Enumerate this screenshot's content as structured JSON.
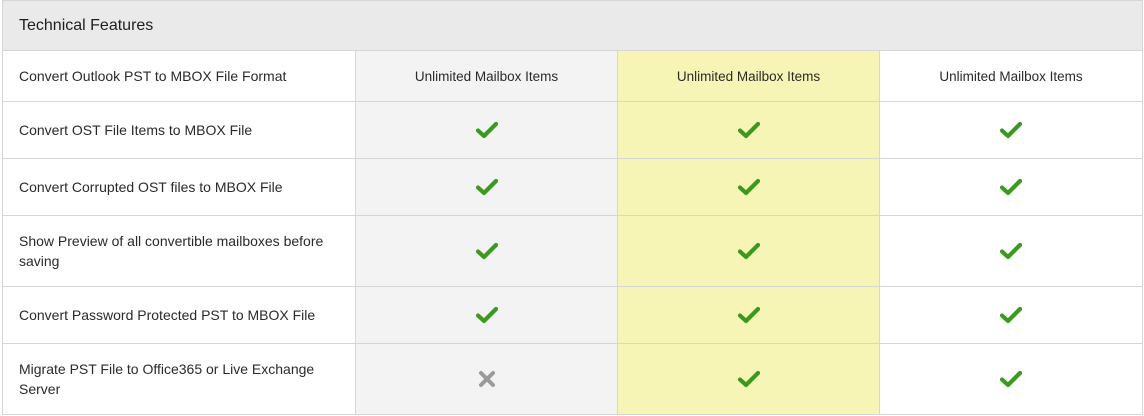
{
  "header": {
    "title": "Technical Features"
  },
  "rows": [
    {
      "feature": "Convert Outlook PST to MBOX File Format",
      "values": [
        {
          "type": "text",
          "text": "Unlimited Mailbox Items"
        },
        {
          "type": "text",
          "text": "Unlimited Mailbox Items"
        },
        {
          "type": "text",
          "text": "Unlimited Mailbox Items"
        }
      ]
    },
    {
      "feature": "Convert OST File Items to MBOX File",
      "values": [
        {
          "type": "check-icon"
        },
        {
          "type": "check-icon"
        },
        {
          "type": "check-icon"
        }
      ]
    },
    {
      "feature": "Convert Corrupted OST files to MBOX File",
      "values": [
        {
          "type": "check-icon"
        },
        {
          "type": "check-icon"
        },
        {
          "type": "check-icon"
        }
      ]
    },
    {
      "feature": "Show Preview of all convertible mailboxes before saving",
      "values": [
        {
          "type": "check-icon"
        },
        {
          "type": "check-icon"
        },
        {
          "type": "check-icon"
        }
      ]
    },
    {
      "feature": "Convert Password Protected PST to MBOX File",
      "values": [
        {
          "type": "check-icon"
        },
        {
          "type": "check-icon"
        },
        {
          "type": "check-icon"
        }
      ]
    },
    {
      "feature": "Migrate PST File to Office365 or Live Exchange Server",
      "values": [
        {
          "type": "cross-icon"
        },
        {
          "type": "check-icon"
        },
        {
          "type": "check-icon"
        }
      ]
    }
  ],
  "colors": {
    "check": "#3a9a1f",
    "cross": "#9a9a9a",
    "highlight_column": "#f7f5b5",
    "muted_column": "#f3f3f3",
    "header_bg": "#eaeaea"
  }
}
